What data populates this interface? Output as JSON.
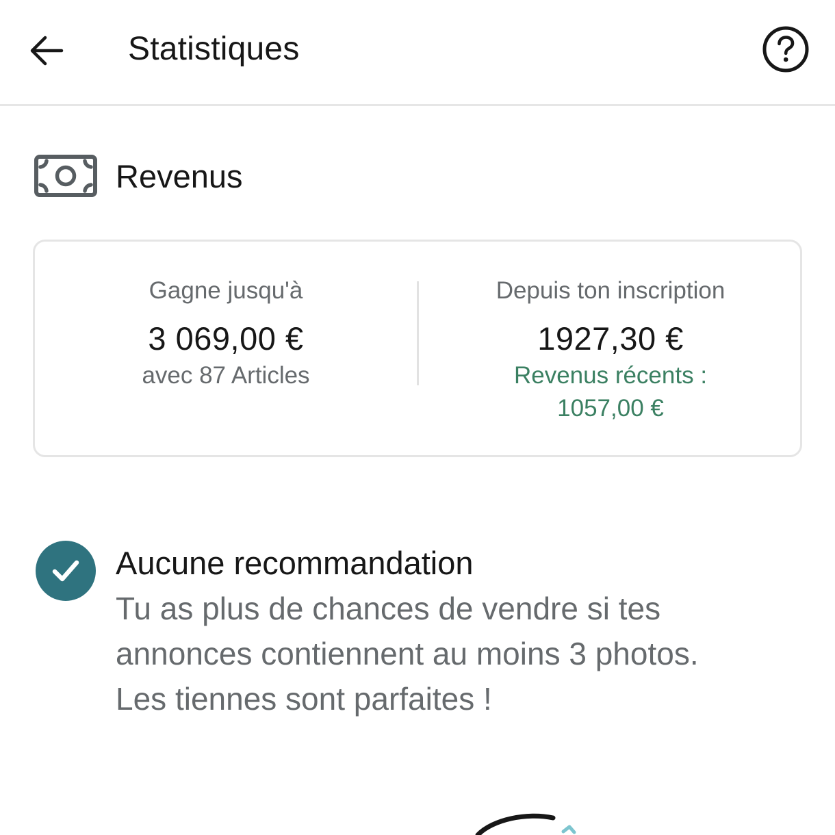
{
  "header": {
    "title": "Statistiques",
    "back_icon": "arrow-left-icon",
    "help_icon": "question-circle-icon"
  },
  "revenue": {
    "section_title": "Revenus",
    "icon": "banknote-icon",
    "earn_up_to": {
      "label": "Gagne jusqu'à",
      "value": "3 069,00 €",
      "sub": "avec 87 Articles"
    },
    "since_signup": {
      "label": "Depuis ton inscription",
      "value": "1927,30 €",
      "recent_label": "Revenus récents :",
      "recent_value": "1057,00 €"
    }
  },
  "recommendation": {
    "icon": "check-circle-icon",
    "title": "Aucune recommandation",
    "lines": [
      "Tu as plus de chances de vendre si tes",
      "annonces contiennent au moins 3 photos.",
      "Les tiennes sont parfaites !"
    ]
  },
  "colors": {
    "accent_teal": "#2f737f",
    "green_text": "#3b8062",
    "muted_text": "#666a6d"
  }
}
